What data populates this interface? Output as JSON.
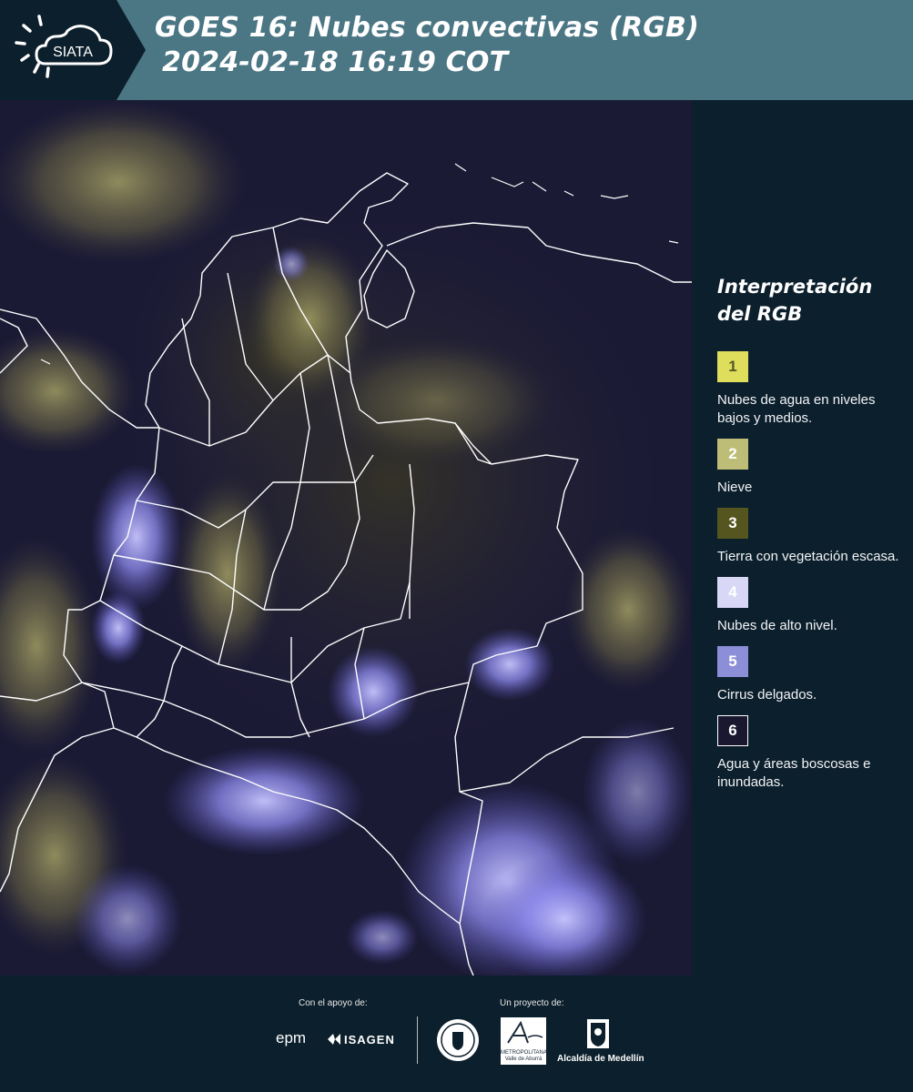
{
  "header": {
    "logo_text": "SIATA",
    "title_line1": "GOES 16: Nubes convectivas (RGB)",
    "title_line2": "2024-02-18 16:19 COT"
  },
  "legend": {
    "title_line1": "Interpretación",
    "title_line2": "del RGB",
    "items": [
      {
        "number": "1",
        "color": "#dede5c",
        "label": "Nubes de agua en niveles bajos y medios."
      },
      {
        "number": "2",
        "color": "#bdbd78",
        "label": "Nieve"
      },
      {
        "number": "3",
        "color": "#55561f",
        "label": "Tierra con vegetación escasa."
      },
      {
        "number": "4",
        "color": "#d9d7f6",
        "label": "Nubes de alto nivel."
      },
      {
        "number": "5",
        "color": "#8d8ed8",
        "label": "Cirrus delgados."
      },
      {
        "number": "6",
        "color": "#1a1830",
        "label": "Agua y áreas boscosas e inundadas."
      }
    ]
  },
  "footer": {
    "support_label": "Con el apoyo de:",
    "project_label": "Un proyecto de:",
    "sponsors": [
      "epm",
      "ISAGEN"
    ],
    "partners": [
      "Área Metropolitana Valle de Aburrá",
      "Alcaldía de Medellín"
    ],
    "area_line1": "METROPOLITANA",
    "area_line2": "Valle de Aburrá",
    "alcaldia": "Alcaldía de Medellín"
  }
}
